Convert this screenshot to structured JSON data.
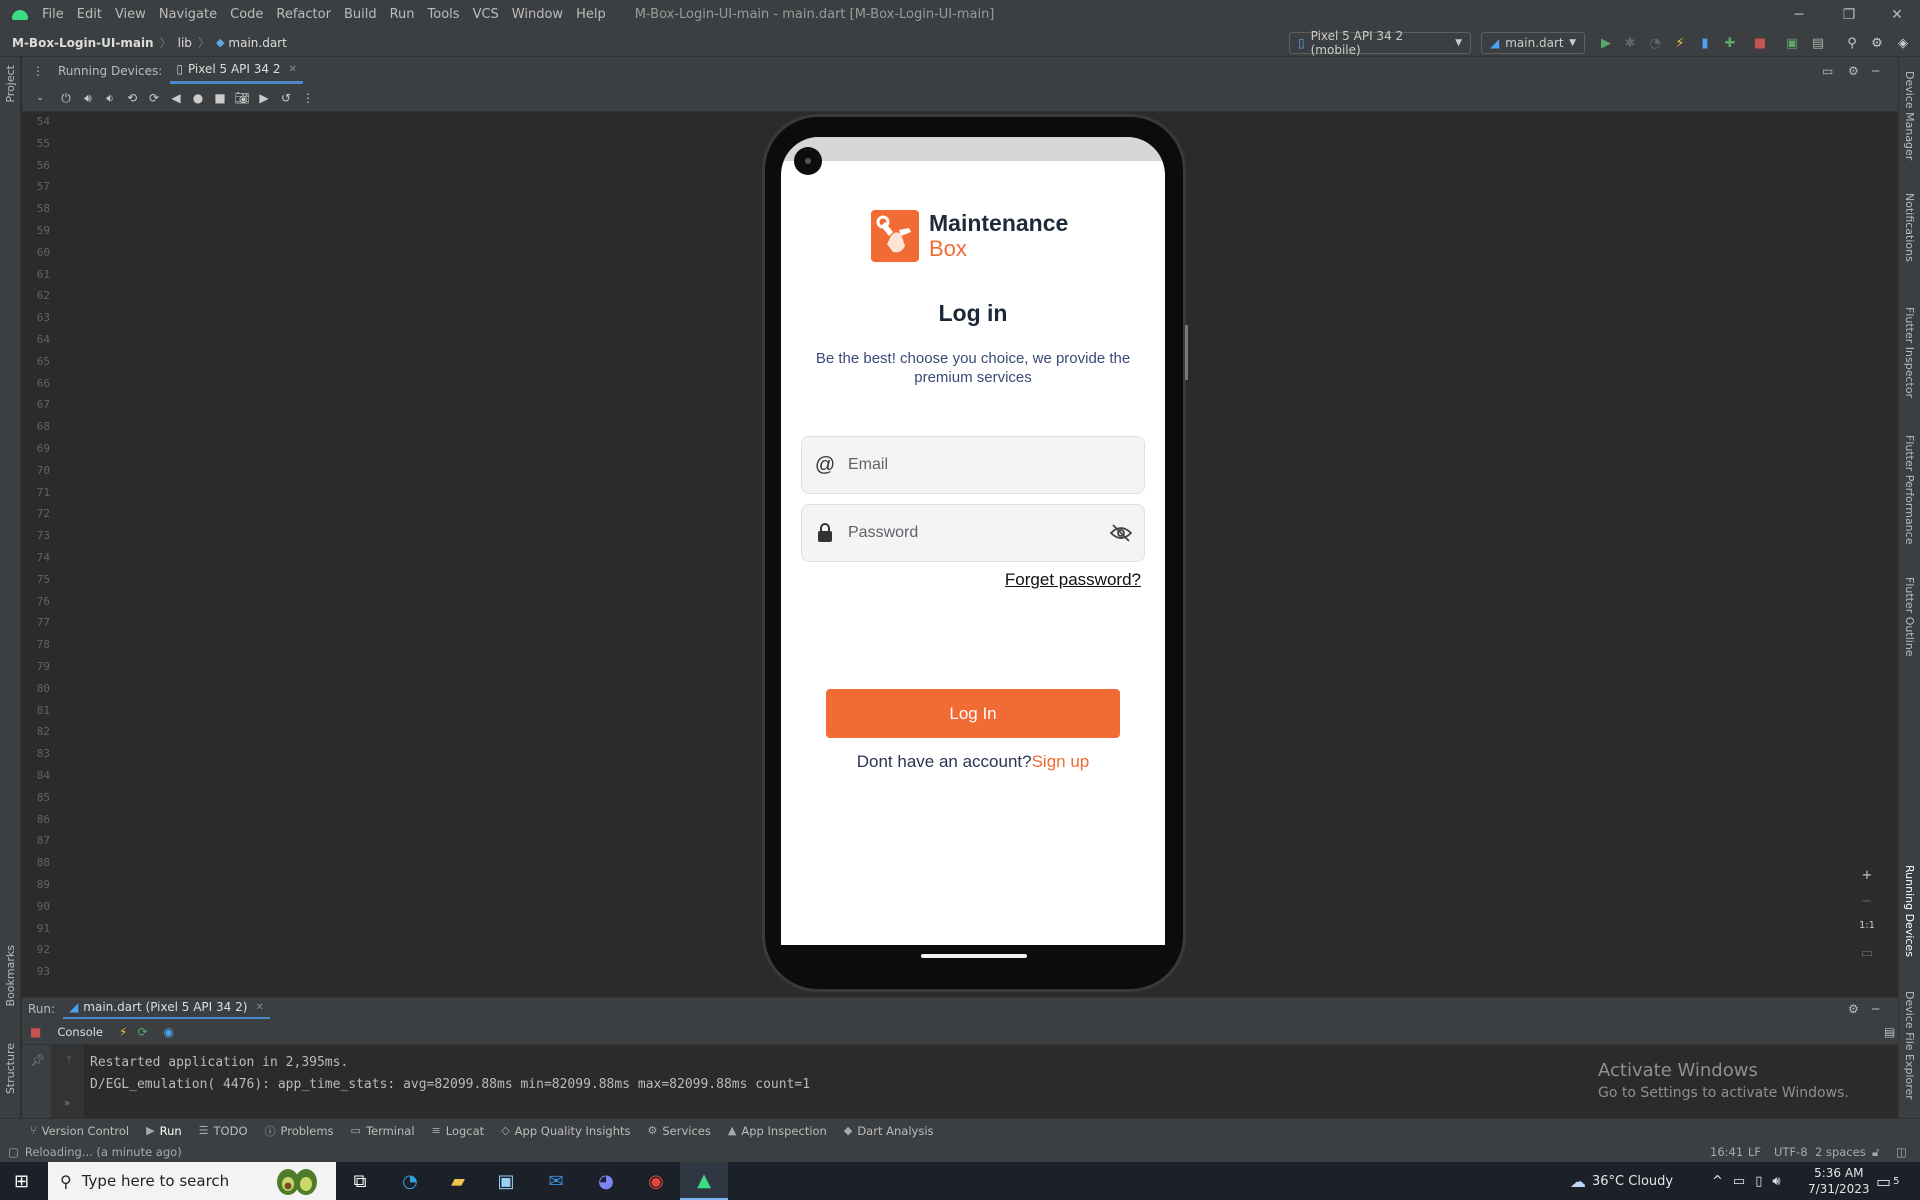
{
  "window": {
    "menu": [
      "File",
      "Edit",
      "View",
      "Navigate",
      "Code",
      "Refactor",
      "Build",
      "Run",
      "Tools",
      "VCS",
      "Window",
      "Help"
    ],
    "title": "M-Box-Login-UI-main - main.dart [M-Box-Login-UI-main]"
  },
  "navbar": {
    "project": "M-Box-Login-UI-main",
    "folder": "lib",
    "file": "main.dart",
    "device_combo": "Pixel 5 API 34 2 (mobile)",
    "config_combo": "main.dart"
  },
  "left_strip": {
    "project": "Project",
    "bookmarks": "Bookmarks",
    "structure": "Structure"
  },
  "right_strip": {
    "items": [
      "Device Manager",
      "Notifications",
      "Flutter Inspector",
      "Flutter Performance",
      "Flutter Outline",
      "Running Devices",
      "Device File Explorer"
    ]
  },
  "running_devices": {
    "label": "Running Devices:",
    "tab": "Pixel 5 API 34 2"
  },
  "editor": {
    "line_numbers": [
      "54",
      "55",
      "56",
      "57",
      "58",
      "59",
      "60",
      "61",
      "62",
      "63",
      "64",
      "65",
      "66",
      "67",
      "68",
      "69",
      "70",
      "71",
      "72",
      "73",
      "74",
      "75",
      "76",
      "77",
      "78",
      "79",
      "80",
      "81",
      "82",
      "83",
      "84",
      "85",
      "86",
      "87",
      "88",
      "89",
      "90",
      "91",
      "92",
      "93"
    ]
  },
  "app": {
    "brand_name1": "Maintenance",
    "brand_name2": "Box",
    "title": "Log in",
    "subtitle": "Be the best!  choose you choice, we provide the premium services",
    "email_placeholder": "Email",
    "password_placeholder": "Password",
    "forgot_password": "Forget password?",
    "login_button": "Log In",
    "no_account": "Dont have an account?",
    "signup": "Sign up",
    "colors": {
      "accent": "#f26a34",
      "heading": "#1b2638",
      "subtitle": "#3a4a78"
    }
  },
  "zoom": {
    "plus": "+",
    "minus": "−",
    "ratio": "1:1"
  },
  "run_panel": {
    "label": "Run:",
    "tab": "main.dart (Pixel 5 API 34 2)",
    "console_tab": "Console",
    "lines": [
      "Restarted application in 2,395ms.",
      "D/EGL_emulation( 4476): app_time_stats: avg=82099.88ms min=82099.88ms max=82099.88ms count=1"
    ]
  },
  "watermark": {
    "line1": "Activate Windows",
    "line2": "Go to Settings to activate Windows."
  },
  "bottom_tabs": [
    "Version Control",
    "Run",
    "TODO",
    "Problems",
    "Terminal",
    "Logcat",
    "App Quality Insights",
    "Services",
    "App Inspection",
    "Dart Analysis"
  ],
  "status": {
    "message": "Reloading... (a minute ago)",
    "position": "16:41",
    "line_sep": "LF",
    "encoding": "UTF-8",
    "indent": "2 spaces"
  },
  "taskbar": {
    "search_placeholder": "Type here to search",
    "weather": "36°C  Cloudy",
    "time": "5:36 AM",
    "date": "7/31/2023",
    "notification_count": "5"
  }
}
